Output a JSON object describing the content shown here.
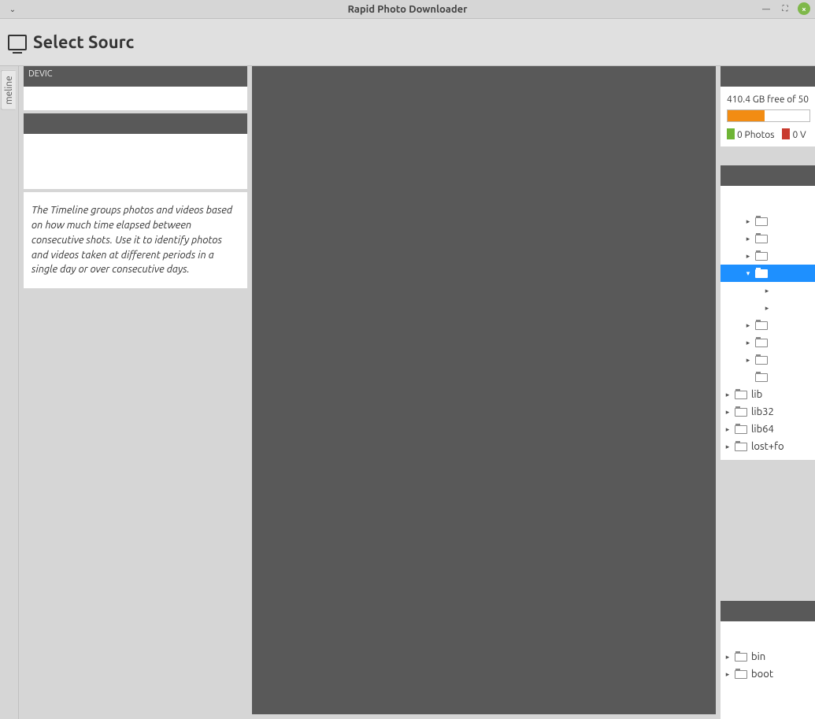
{
  "titlebar": {
    "title": "Rapid Photo Downloader"
  },
  "header": {
    "select_source": "Select Sourc"
  },
  "vtab": {
    "label": "meline"
  },
  "left": {
    "devices_label": "DEVIC",
    "timeline_help": "The Timeline groups photos and videos based on how much time elapsed between consecutive shots. Use it to identify photos and videos taken at different periods in a single day or over consecutive days."
  },
  "storage": {
    "free_text": "410.4 GB free of 50",
    "photos_label": "0 Photos",
    "videos_label": "0 V",
    "used_pct": 45
  },
  "tree1": {
    "rows": [
      {
        "indent": "pad1",
        "arrow": "right",
        "folder": true,
        "label": "",
        "selected": false
      },
      {
        "indent": "pad1",
        "arrow": "right",
        "folder": true,
        "label": "",
        "selected": false
      },
      {
        "indent": "pad1",
        "arrow": "right",
        "folder": true,
        "label": "",
        "selected": false
      },
      {
        "indent": "pad1",
        "arrow": "down",
        "folder": true,
        "label": "",
        "selected": true
      },
      {
        "indent": "pad2",
        "arrow": "right",
        "folder": false,
        "label": "",
        "selected": false
      },
      {
        "indent": "pad2",
        "arrow": "right",
        "folder": false,
        "label": "",
        "selected": false
      },
      {
        "indent": "pad1",
        "arrow": "right",
        "folder": true,
        "label": "",
        "selected": false
      },
      {
        "indent": "pad1",
        "arrow": "right",
        "folder": true,
        "label": "",
        "selected": false
      },
      {
        "indent": "pad1",
        "arrow": "right",
        "folder": true,
        "label": "",
        "selected": false
      },
      {
        "indent": "pad1",
        "arrow": "",
        "folder": true,
        "label": "",
        "selected": false
      },
      {
        "indent": "pad0",
        "arrow": "right",
        "folder": true,
        "label": "lib",
        "selected": false
      },
      {
        "indent": "pad0",
        "arrow": "right",
        "folder": true,
        "label": "lib32",
        "selected": false
      },
      {
        "indent": "pad0",
        "arrow": "right",
        "folder": true,
        "label": "lib64",
        "selected": false
      },
      {
        "indent": "pad0",
        "arrow": "right",
        "folder": true,
        "label": "lost+fo",
        "selected": false
      }
    ]
  },
  "tree2": {
    "rows": [
      {
        "indent": "pad0",
        "arrow": "right",
        "folder": true,
        "label": "bin",
        "selected": false
      },
      {
        "indent": "pad0",
        "arrow": "right",
        "folder": true,
        "label": "boot",
        "selected": false
      }
    ]
  }
}
